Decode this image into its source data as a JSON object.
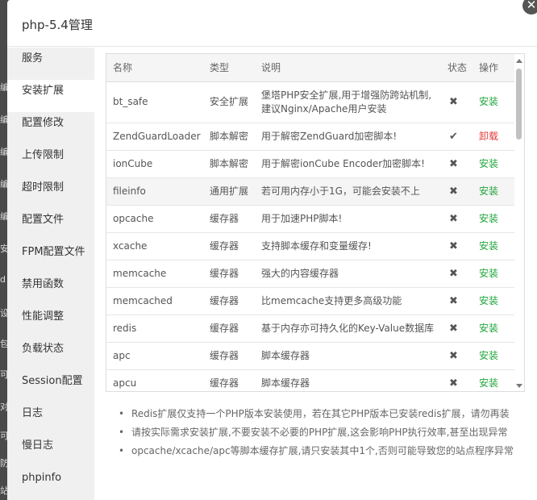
{
  "dialog": {
    "title": "php-5.4管理",
    "close_glyph": "✕"
  },
  "backdrop_fragments": [
    "编",
    "编",
    "编",
    "编",
    "编",
    "安",
    "d",
    "设",
    "包",
    "可",
    "对",
    "可",
    "防",
    "站"
  ],
  "sidebar": {
    "items": [
      {
        "label": "服务",
        "active": false
      },
      {
        "label": "安装扩展",
        "active": true
      },
      {
        "label": "配置修改",
        "active": false
      },
      {
        "label": "上传限制",
        "active": false
      },
      {
        "label": "超时限制",
        "active": false
      },
      {
        "label": "配置文件",
        "active": false
      },
      {
        "label": "FPM配置文件",
        "active": false
      },
      {
        "label": "禁用函数",
        "active": false
      },
      {
        "label": "性能调整",
        "active": false
      },
      {
        "label": "负载状态",
        "active": false
      },
      {
        "label": "Session配置",
        "active": false
      },
      {
        "label": "日志",
        "active": false
      },
      {
        "label": "慢日志",
        "active": false
      },
      {
        "label": "phpinfo",
        "active": false
      }
    ]
  },
  "table": {
    "headers": {
      "name": "名称",
      "type": "类型",
      "desc": "说明",
      "status": "状态",
      "op": "操作"
    },
    "rows": [
      {
        "name": "bt_safe",
        "type": "安全扩展",
        "desc": "堡塔PHP安全扩展,用于增强防跨站机制,建议Nginx/Apache用户安装",
        "status": "✖",
        "op": "安装",
        "op_kind": "install"
      },
      {
        "name": "ZendGuardLoader",
        "type": "脚本解密",
        "desc": "用于解密ZendGuard加密脚本!",
        "status": "✔",
        "op": "卸载",
        "op_kind": "uninstall"
      },
      {
        "name": "ionCube",
        "type": "脚本解密",
        "desc": "用于解密ionCube Encoder加密脚本!",
        "status": "✖",
        "op": "安装",
        "op_kind": "install"
      },
      {
        "name": "fileinfo",
        "type": "通用扩展",
        "desc": "若可用内存小于1G，可能会安装不上",
        "status": "✖",
        "op": "安装",
        "op_kind": "install"
      },
      {
        "name": "opcache",
        "type": "缓存器",
        "desc": "用于加速PHP脚本!",
        "status": "✖",
        "op": "安装",
        "op_kind": "install"
      },
      {
        "name": "xcache",
        "type": "缓存器",
        "desc": "支持脚本缓存和变量缓存!",
        "status": "✖",
        "op": "安装",
        "op_kind": "install"
      },
      {
        "name": "memcache",
        "type": "缓存器",
        "desc": "强大的内容缓存器",
        "status": "✖",
        "op": "安装",
        "op_kind": "install"
      },
      {
        "name": "memcached",
        "type": "缓存器",
        "desc": "比memcache支持更多高级功能",
        "status": "✖",
        "op": "安装",
        "op_kind": "install"
      },
      {
        "name": "redis",
        "type": "缓存器",
        "desc": "基于内存亦可持久化的Key-Value数据库",
        "status": "✖",
        "op": "安装",
        "op_kind": "install"
      },
      {
        "name": "apc",
        "type": "缓存器",
        "desc": "脚本缓存器",
        "status": "✖",
        "op": "安装",
        "op_kind": "install"
      },
      {
        "name": "apcu",
        "type": "缓存器",
        "desc": "脚本缓存器",
        "status": "✖",
        "op": "安装",
        "op_kind": "install"
      }
    ]
  },
  "notes": [
    "Redis扩展仅支持一个PHP版本安装使用，若在其它PHP版本已安装redis扩展，请勿再装",
    "请按实际需求安装扩展,不要安装不必要的PHP扩展,这会影响PHP执行效率,甚至出现异常",
    "opcache/xcache/apc等脚本缓存扩展,请只安装其中1个,否则可能导致您的站点程序异常"
  ],
  "colors": {
    "install": "#20a53a",
    "uninstall": "#e4393c"
  }
}
